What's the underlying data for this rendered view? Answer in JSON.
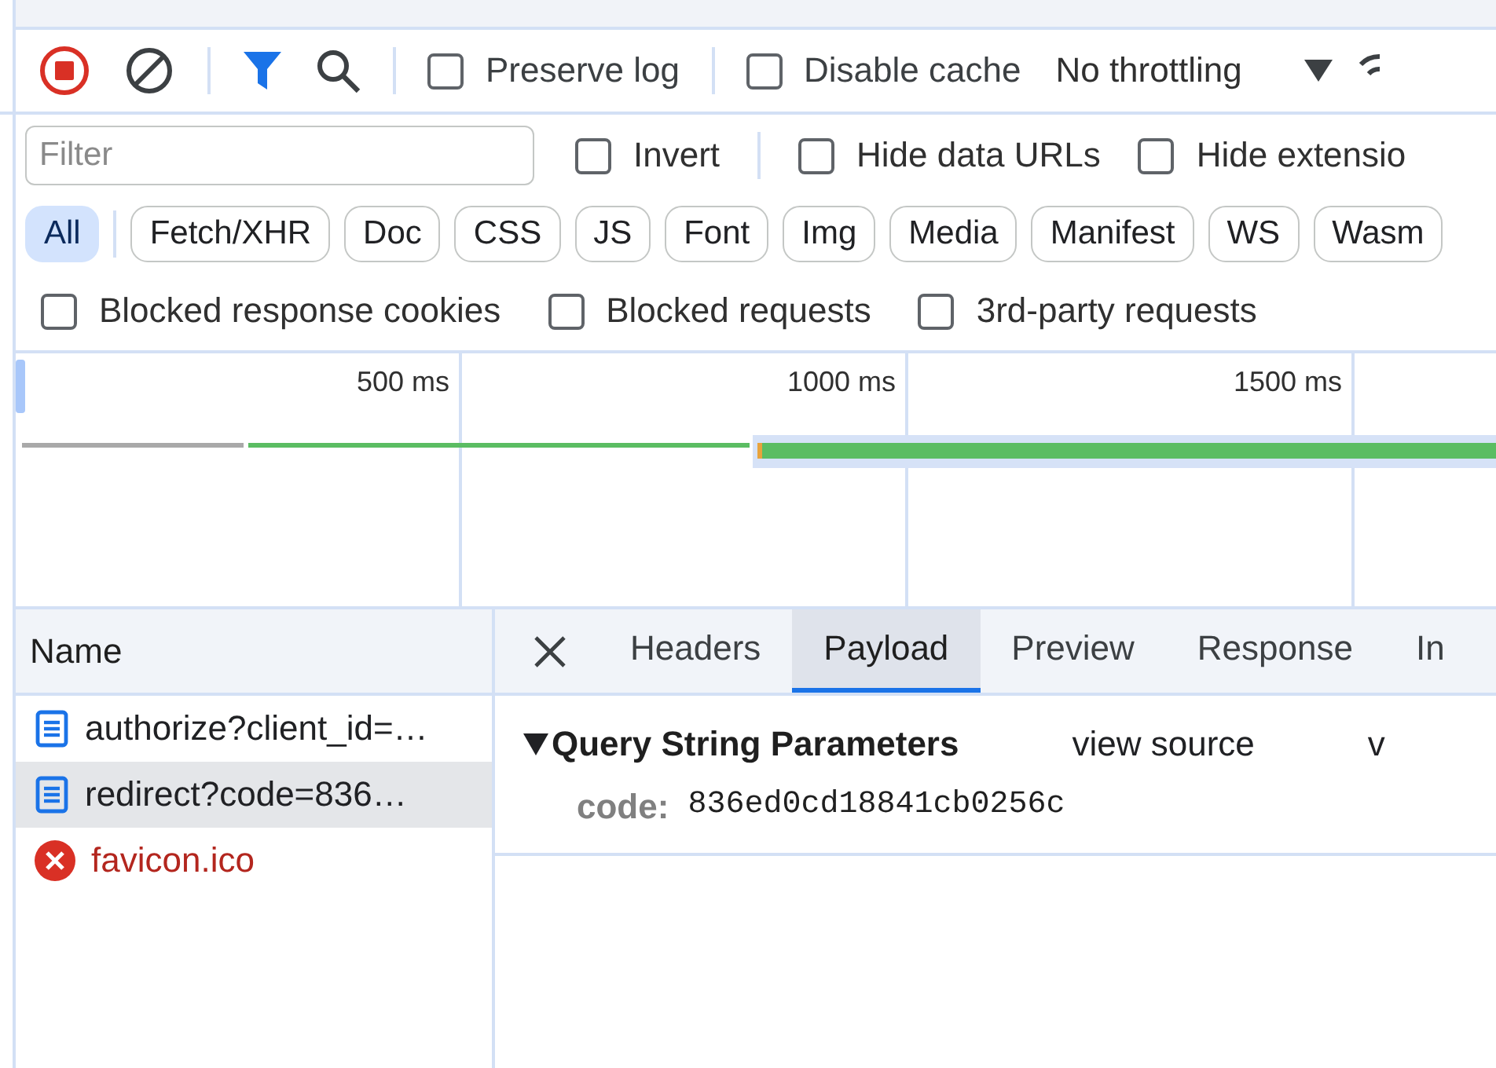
{
  "toolbar": {
    "recording": true,
    "options": [
      {
        "label": "Preserve log",
        "checked": false
      },
      {
        "label": "Disable cache",
        "checked": false
      }
    ],
    "throttling": "No throttling"
  },
  "filter": {
    "placeholder": "Filter",
    "options": [
      {
        "label": "Invert",
        "checked": false
      },
      {
        "label": "Hide data URLs",
        "checked": false
      },
      {
        "label": "Hide extensio",
        "checked": false
      }
    ]
  },
  "type_filters": [
    {
      "label": "All",
      "selected": true
    },
    {
      "label": "Fetch/XHR",
      "selected": false
    },
    {
      "label": "Doc",
      "selected": false
    },
    {
      "label": "CSS",
      "selected": false
    },
    {
      "label": "JS",
      "selected": false
    },
    {
      "label": "Font",
      "selected": false
    },
    {
      "label": "Img",
      "selected": false
    },
    {
      "label": "Media",
      "selected": false
    },
    {
      "label": "Manifest",
      "selected": false
    },
    {
      "label": "WS",
      "selected": false
    },
    {
      "label": "Wasm",
      "selected": false
    }
  ],
  "blocked_options": [
    {
      "label": "Blocked response cookies",
      "checked": false
    },
    {
      "label": "Blocked requests",
      "checked": false
    },
    {
      "label": "3rd-party requests",
      "checked": false
    }
  ],
  "overview": {
    "ticks": [
      "500 ms",
      "1000 ms",
      "1500 ms"
    ]
  },
  "requests": {
    "column": "Name",
    "rows": [
      {
        "name": "authorize?client_id=…",
        "kind": "document",
        "selected": false
      },
      {
        "name": "redirect?code=836…",
        "kind": "document",
        "selected": true
      },
      {
        "name": "favicon.ico",
        "kind": "error",
        "selected": false
      }
    ]
  },
  "detail": {
    "tabs": [
      {
        "label": "Headers",
        "selected": false
      },
      {
        "label": "Payload",
        "selected": true
      },
      {
        "label": "Preview",
        "selected": false
      },
      {
        "label": "Response",
        "selected": false
      },
      {
        "label": "In",
        "selected": false
      }
    ],
    "section": {
      "title": "Query String Parameters",
      "expanded": true,
      "actions": [
        "view source",
        "v"
      ],
      "params": [
        {
          "key": "code:",
          "value": "836ed0cd18841cb0256c"
        }
      ]
    }
  }
}
